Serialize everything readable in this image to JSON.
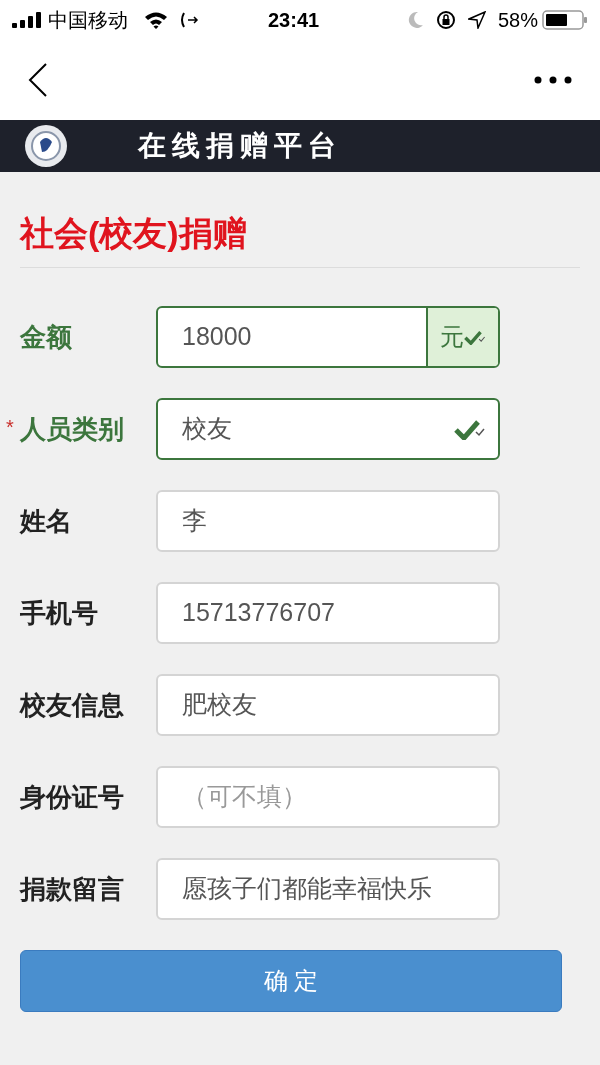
{
  "status_bar": {
    "carrier": "中国移动",
    "time": "23:41",
    "battery": "58%"
  },
  "header": {
    "title": "在线捐赠平台"
  },
  "section_title": "社会(校友)捐赠",
  "fields": [
    {
      "label": "金额",
      "value": "18000",
      "valid": true,
      "addon": "元"
    },
    {
      "label": "人员类别",
      "value": "校友",
      "valid": true,
      "required_mark": "*"
    },
    {
      "label": "姓名",
      "value": "李",
      "valid": false
    },
    {
      "label": "手机号",
      "value": "15713776707",
      "valid": false
    },
    {
      "label": "校友信息",
      "value": "肥校友",
      "valid": false
    },
    {
      "label": "身份证号",
      "placeholder": "（可不填）",
      "valid": false
    },
    {
      "label": "捐款留言",
      "value": "愿孩子们都能幸福快乐",
      "valid": false
    }
  ],
  "submit": "确 定"
}
